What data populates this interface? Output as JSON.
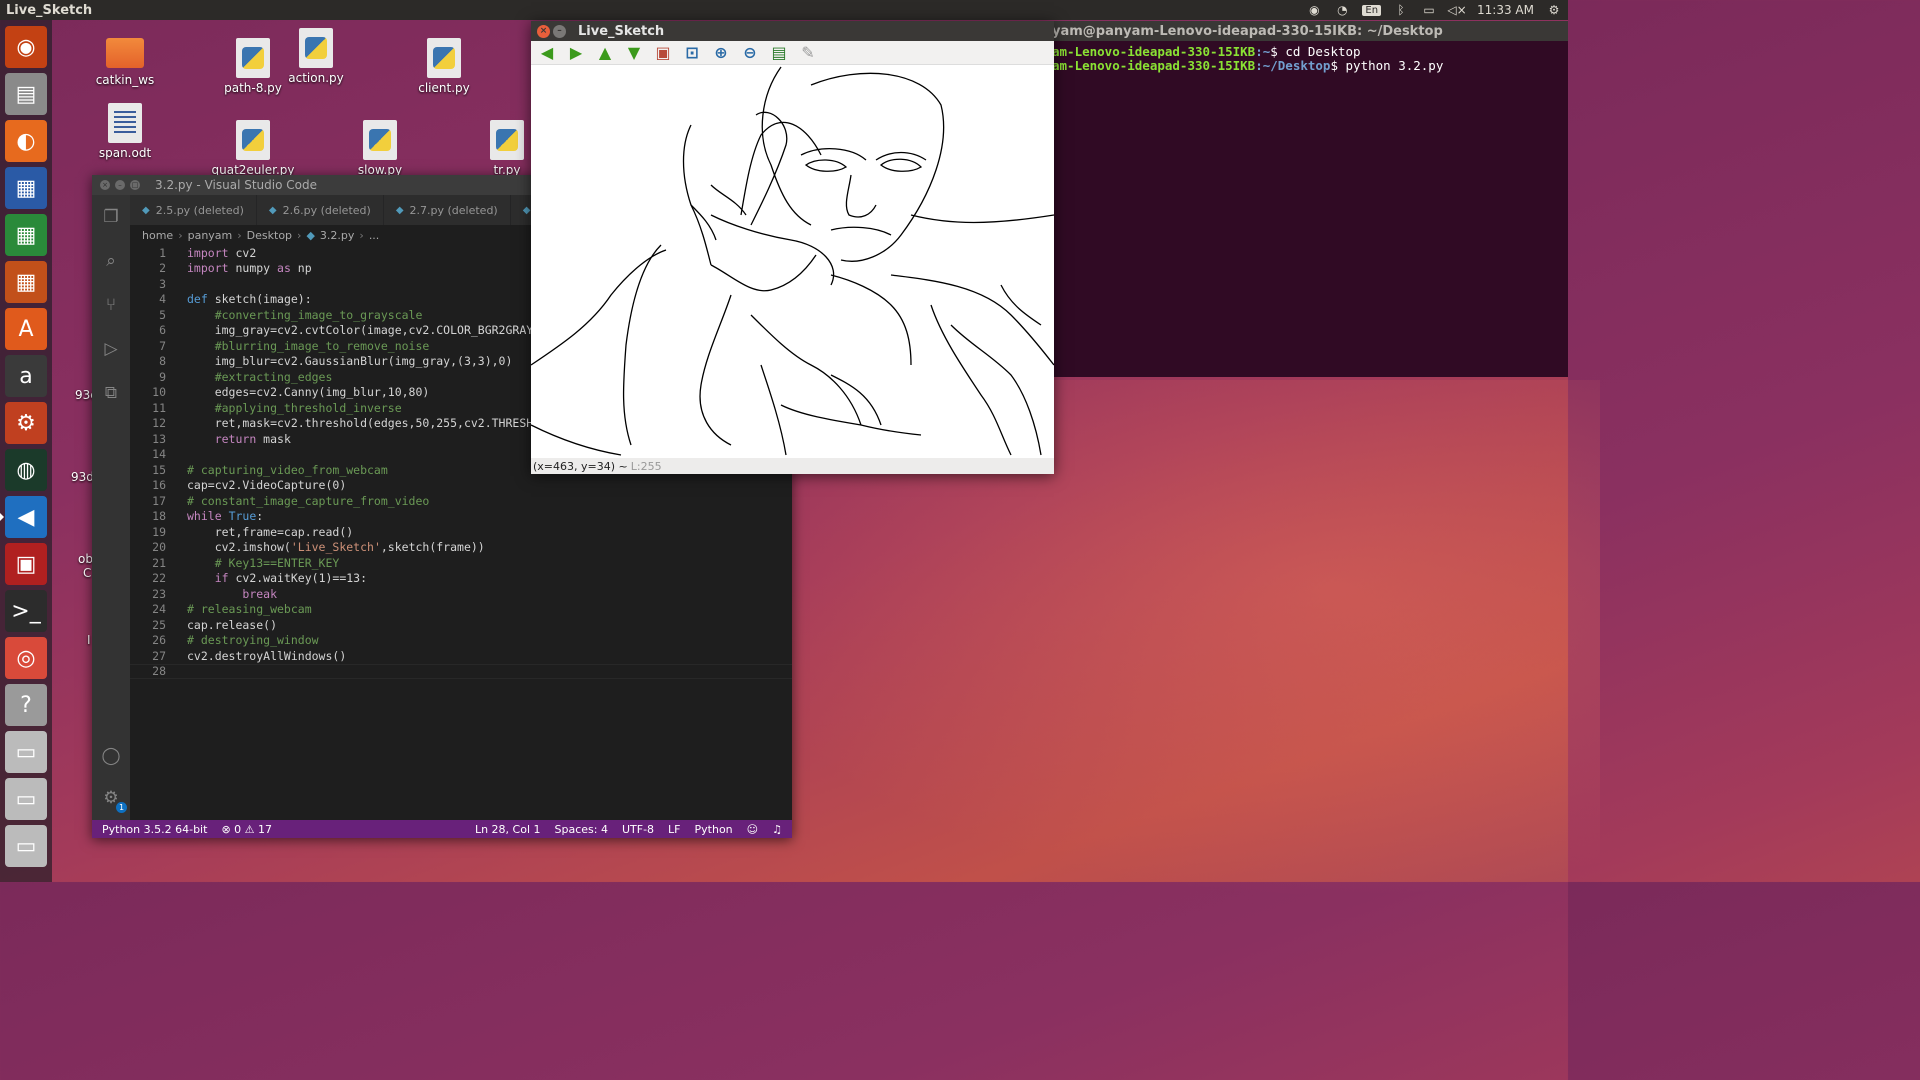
{
  "top_panel": {
    "app_title": "Live_Sketch",
    "lang": "En",
    "clock": "11:33 AM"
  },
  "launcher": {
    "items": [
      {
        "name": "ubuntu-dash",
        "glyph": "◉",
        "color": "#c34113"
      },
      {
        "name": "files",
        "glyph": "▤",
        "color": "#8a8a8a"
      },
      {
        "name": "firefox",
        "glyph": "◐",
        "color": "#e76a1e"
      },
      {
        "name": "writer",
        "glyph": "▦",
        "color": "#2a5aa6"
      },
      {
        "name": "calc",
        "glyph": "▦",
        "color": "#2a8a3a"
      },
      {
        "name": "impress",
        "glyph": "▦",
        "color": "#c2501a"
      },
      {
        "name": "software-center",
        "glyph": "A",
        "color": "#e05a1c"
      },
      {
        "name": "amazon",
        "glyph": "a",
        "color": "#3a3a3a"
      },
      {
        "name": "system-settings",
        "glyph": "⚙",
        "color": "#c04020"
      },
      {
        "name": "globe-app",
        "glyph": "◍",
        "color": "#1b3a2a"
      },
      {
        "name": "vscode",
        "glyph": "◀",
        "color": "#1f6fc0"
      },
      {
        "name": "red-app",
        "glyph": "▣",
        "color": "#b02020"
      },
      {
        "name": "terminal",
        "glyph": ">_",
        "color": "#2c2c2c"
      },
      {
        "name": "pdf-viewer",
        "glyph": "◎",
        "color": "#d94a3a"
      },
      {
        "name": "help",
        "glyph": "?",
        "color": "#9a9a9a"
      },
      {
        "name": "drive-1",
        "glyph": "▭",
        "color": "#bbbbbb"
      },
      {
        "name": "drive-2",
        "glyph": "▭",
        "color": "#bbbbbb"
      },
      {
        "name": "trash",
        "glyph": "▭",
        "color": "#bbbbbb"
      }
    ]
  },
  "desktop": {
    "icons": [
      {
        "label": "catkin_ws",
        "kind": "folder"
      },
      {
        "label": "path-8.py",
        "kind": "py"
      },
      {
        "label": "action.py",
        "kind": "py"
      },
      {
        "label": "client.py",
        "kind": "py"
      },
      {
        "label": "span.odt",
        "kind": "doc"
      },
      {
        "label": "quat2euler.py",
        "kind": "py"
      },
      {
        "label": "slow.py",
        "kind": "py"
      },
      {
        "label": "tr.py",
        "kind": "py"
      }
    ],
    "partial_labels": [
      "93c",
      "93d",
      "ob",
      "C",
      "I"
    ]
  },
  "vscode": {
    "title": "3.2.py - Visual Studio Code",
    "tabs": [
      "2.5.py (deleted)",
      "2.6.py (deleted)",
      "2.7.py (deleted)",
      ""
    ],
    "breadcrumb": [
      "home",
      "panyam",
      "Desktop",
      "3.2.py",
      "..."
    ],
    "code_lines": [
      "import cv2",
      "import numpy as np",
      "",
      "def sketch(image):",
      "    #converting_image_to_grayscale",
      "    img_gray=cv2.cvtColor(image,cv2.COLOR_BGR2GRAY",
      "    #blurring_image_to_remove_noise",
      "    img_blur=cv2.GaussianBlur(img_gray,(3,3),0)",
      "    #extracting_edges",
      "    edges=cv2.Canny(img_blur,10,80)",
      "    #applying_threshold_inverse",
      "    ret,mask=cv2.threshold(edges,50,255,cv2.THRESH",
      "    return mask",
      "",
      "# capturing_video_from_webcam",
      "cap=cv2.VideoCapture(0)",
      "# constant_image_capture_from_video",
      "while True:",
      "    ret,frame=cap.read()",
      "    cv2.imshow('Live_Sketch',sketch(frame))",
      "    # Key13==ENTER_KEY",
      "    if cv2.waitKey(1)==13:",
      "        break",
      "# releasing_webcam",
      "cap.release()",
      "# destroying_window",
      "cv2.destroyAllWindows()",
      ""
    ],
    "line_numbers": [
      "1",
      "2",
      "3",
      "4",
      "5",
      "6",
      "7",
      "8",
      "9",
      "10",
      "11",
      "12",
      "13",
      "14",
      "15",
      "16",
      "17",
      "18",
      "19",
      "20",
      "21",
      "22",
      "23",
      "24",
      "25",
      "26",
      "27",
      "28"
    ],
    "status": {
      "interpreter": "Python 3.5.2 64-bit",
      "errors": "0",
      "warnings": "17",
      "position": "Ln 28, Col 1",
      "spaces": "Spaces: 4",
      "encoding": "UTF-8",
      "eol": "LF",
      "language": "Python",
      "settings_badge": "1"
    }
  },
  "sketch_window": {
    "title": "Live_Sketch",
    "status_coords": "(x=463, y=34) ~",
    "status_level": "L:255"
  },
  "terminal": {
    "title": "yam@panyam-Lenovo-ideapad-330-15IKB: ~/Desktop",
    "lines": [
      {
        "user": "am-Lenovo-ideapad-330-15IKB",
        "path": ":~",
        "cmd": "$ cd Desktop"
      },
      {
        "user": "am-Lenovo-ideapad-330-15IKB",
        "path": ":~/Desktop",
        "cmd": "$ python 3.2.py"
      }
    ]
  }
}
